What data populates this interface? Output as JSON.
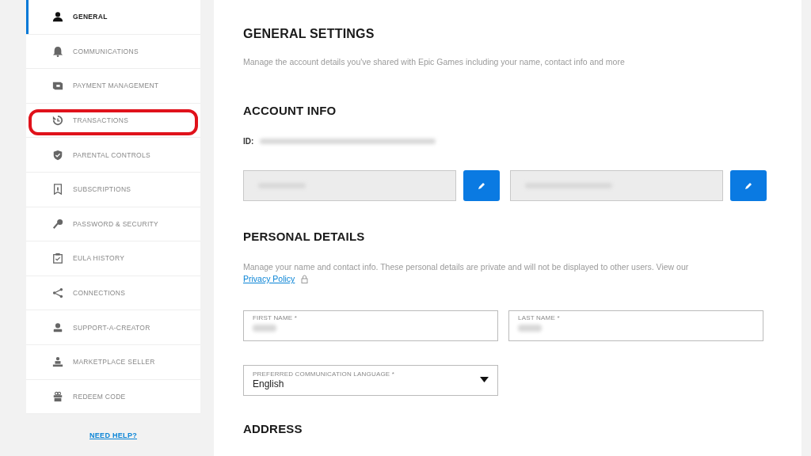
{
  "sidebar": {
    "items": [
      {
        "label": "GENERAL",
        "selected": true,
        "highlighted": false
      },
      {
        "label": "COMMUNICATIONS",
        "selected": false,
        "highlighted": false
      },
      {
        "label": "PAYMENT MANAGEMENT",
        "selected": false,
        "highlighted": false
      },
      {
        "label": "TRANSACTIONS",
        "selected": false,
        "highlighted": true
      },
      {
        "label": "PARENTAL CONTROLS",
        "selected": false,
        "highlighted": false
      },
      {
        "label": "SUBSCRIPTIONS",
        "selected": false,
        "highlighted": false
      },
      {
        "label": "PASSWORD & SECURITY",
        "selected": false,
        "highlighted": false
      },
      {
        "label": "EULA HISTORY",
        "selected": false,
        "highlighted": false
      },
      {
        "label": "CONNECTIONS",
        "selected": false,
        "highlighted": false
      },
      {
        "label": "SUPPORT-A-CREATOR",
        "selected": false,
        "highlighted": false
      },
      {
        "label": "MARKETPLACE SELLER",
        "selected": false,
        "highlighted": false
      },
      {
        "label": "REDEEM CODE",
        "selected": false,
        "highlighted": false
      }
    ],
    "help_link": "NEED HELP?"
  },
  "main": {
    "title": "GENERAL SETTINGS",
    "description": "Manage the account details you've shared with Epic Games including your name, contact info and more",
    "account_info": {
      "heading": "ACCOUNT INFO",
      "id_label": "ID:"
    },
    "personal_details": {
      "heading": "PERSONAL DETAILS",
      "description": "Manage your name and contact info. These personal details are private and will not be displayed to other users. View our",
      "privacy_link": "Privacy Policy",
      "fields": [
        {
          "label": "FIRST NAME *"
        },
        {
          "label": "LAST NAME *"
        }
      ],
      "language": {
        "label": "PREFERRED COMMUNICATION LANGUAGE *",
        "value": "English"
      }
    },
    "address_heading": "ADDRESS"
  }
}
